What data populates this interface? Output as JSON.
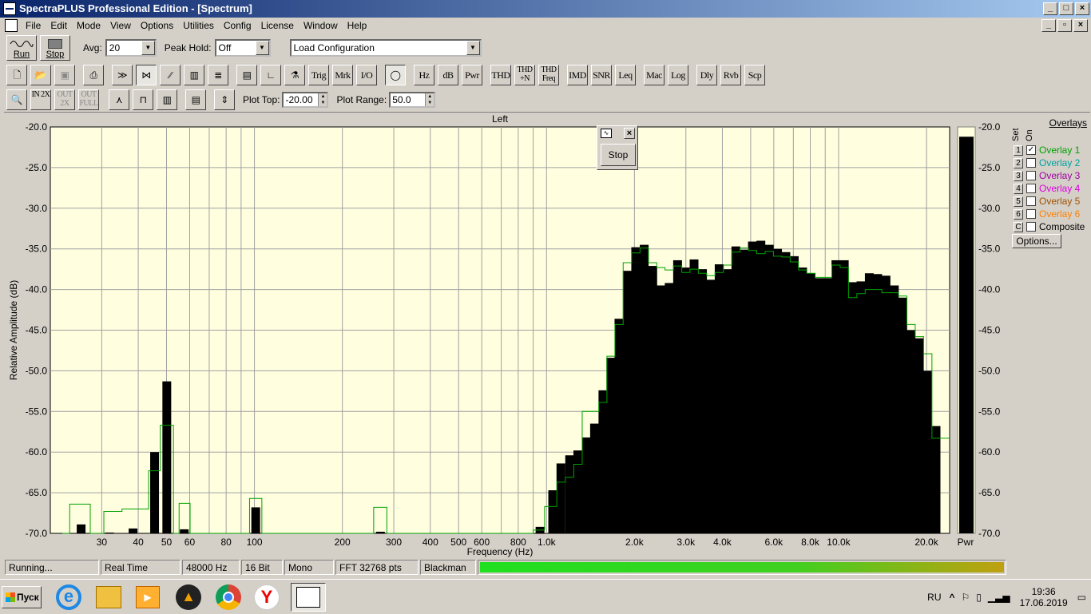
{
  "window": {
    "title": "SpectraPLUS Professional Edition - [Spectrum]"
  },
  "menu": [
    "File",
    "Edit",
    "Mode",
    "View",
    "Options",
    "Utilities",
    "Config",
    "License",
    "Window",
    "Help"
  ],
  "toolbar1": {
    "run": "Run",
    "stop": "Stop",
    "avg_label": "Avg:",
    "avg_value": "20",
    "peak_label": "Peak Hold:",
    "peak_value": "Off",
    "config_value": "Load Configuration"
  },
  "toolbar2": [
    "Trig",
    "Mrk",
    "I/O",
    "Hz",
    "dB",
    "Pwr",
    "THD",
    "THD +N",
    "THD Freq",
    "IMD",
    "SNR",
    "Leq",
    "Mac",
    "Log",
    "Dly",
    "Rvb",
    "Scp"
  ],
  "toolbar3": {
    "zoom_in": "IN 2X",
    "zoom_out": "OUT 2X",
    "zoom_full": "OUT FULL",
    "plot_top_label": "Plot Top:",
    "plot_top_value": "-20.00",
    "plot_range_label": "Plot Range:",
    "plot_range_value": "50.0"
  },
  "float_dialog": {
    "stop": "Stop"
  },
  "overlays": {
    "title": "Overlays",
    "set": "Set",
    "on": "On",
    "items": [
      {
        "num": "1",
        "label": "Overlay 1",
        "checked": true,
        "color": "#00a000"
      },
      {
        "num": "2",
        "label": "Overlay 2",
        "checked": false,
        "color": "#00a0a0"
      },
      {
        "num": "3",
        "label": "Overlay 3",
        "checked": false,
        "color": "#a000a0"
      },
      {
        "num": "4",
        "label": "Overlay 4",
        "checked": false,
        "color": "#e000e0"
      },
      {
        "num": "5",
        "label": "Overlay 5",
        "checked": false,
        "color": "#a05000"
      },
      {
        "num": "6",
        "label": "Overlay 6",
        "checked": false,
        "color": "#ff7f00"
      },
      {
        "num": "C",
        "label": "Composite",
        "checked": false,
        "color": "#000000"
      }
    ],
    "options": "Options..."
  },
  "status": {
    "state": "Running...",
    "mode": "Real Time",
    "rate": "48000 Hz",
    "bits": "16 Bit",
    "channels": "Mono",
    "fft": "FFT 32768 pts",
    "window": "Blackman"
  },
  "taskbar": {
    "start": "Пуск",
    "lang": "RU",
    "time": "19:36",
    "date": "17.06.2019"
  },
  "chart_data": {
    "type": "bar",
    "title": "Left",
    "xlabel": "Frequency (Hz)",
    "ylabel": "Relative Amplitude (dB)",
    "ylim": [
      -70,
      -20
    ],
    "xscale": "log",
    "xlim": [
      20,
      24000
    ],
    "yticks": [
      "-20.0",
      "-25.0",
      "-30.0",
      "-35.0",
      "-40.0",
      "-45.0",
      "-50.0",
      "-55.0",
      "-60.0",
      "-65.0",
      "-70.0"
    ],
    "xticks": [
      {
        "v": 30,
        "t": "30"
      },
      {
        "v": 40,
        "t": "40"
      },
      {
        "v": 50,
        "t": "50"
      },
      {
        "v": 60,
        "t": "60"
      },
      {
        "v": 80,
        "t": "80"
      },
      {
        "v": 100,
        "t": "100"
      },
      {
        "v": 200,
        "t": "200"
      },
      {
        "v": 300,
        "t": "300"
      },
      {
        "v": 400,
        "t": "400"
      },
      {
        "v": 500,
        "t": "500"
      },
      {
        "v": 600,
        "t": "600"
      },
      {
        "v": 800,
        "t": "800"
      },
      {
        "v": 1000,
        "t": "1.0k"
      },
      {
        "v": 2000,
        "t": "2.0k"
      },
      {
        "v": 3000,
        "t": "3.0k"
      },
      {
        "v": 4000,
        "t": "4.0k"
      },
      {
        "v": 6000,
        "t": "6.0k"
      },
      {
        "v": 8000,
        "t": "8.0k"
      },
      {
        "v": 10000,
        "t": "10.0k"
      },
      {
        "v": 20000,
        "t": "20.0k"
      }
    ],
    "bars": [
      [
        25.5,
        -68.9
      ],
      [
        31.9,
        -69.9
      ],
      [
        38.4,
        -69.4
      ],
      [
        45.5,
        -60.0
      ],
      [
        50.1,
        -51.3
      ],
      [
        57.5,
        -69.5
      ],
      [
        101,
        -66.8
      ],
      [
        270,
        -69.8
      ],
      [
        950,
        -69.2
      ],
      [
        1050,
        -64.7
      ],
      [
        1120,
        -61.4
      ],
      [
        1200,
        -60.4
      ],
      [
        1280,
        -59.8
      ],
      [
        1370,
        -58.2
      ],
      [
        1460,
        -56.5
      ],
      [
        1560,
        -52.4
      ],
      [
        1660,
        -48.4
      ],
      [
        1770,
        -43.6
      ],
      [
        1890,
        -37.7
      ],
      [
        2020,
        -34.8
      ],
      [
        2160,
        -34.5
      ],
      [
        2310,
        -37.1
      ],
      [
        2460,
        -39.5
      ],
      [
        2630,
        -39.2
      ],
      [
        2810,
        -36.4
      ],
      [
        3000,
        -37.3
      ],
      [
        3200,
        -36.3
      ],
      [
        3420,
        -37.5
      ],
      [
        3650,
        -38.8
      ],
      [
        3900,
        -36.9
      ],
      [
        4170,
        -37.5
      ],
      [
        4450,
        -34.7
      ],
      [
        4750,
        -35.1
      ],
      [
        5070,
        -34.1
      ],
      [
        5420,
        -34.0
      ],
      [
        5790,
        -34.5
      ],
      [
        6180,
        -35.0
      ],
      [
        6600,
        -35.4
      ],
      [
        7050,
        -35.9
      ],
      [
        7530,
        -37.3
      ],
      [
        8040,
        -38.0
      ],
      [
        8590,
        -38.6
      ],
      [
        9170,
        -38.6
      ],
      [
        9790,
        -36.4
      ],
      [
        10460,
        -36.4
      ],
      [
        11170,
        -39.1
      ],
      [
        11930,
        -39.0
      ],
      [
        12740,
        -38.0
      ],
      [
        13610,
        -38.1
      ],
      [
        14530,
        -38.3
      ],
      [
        15520,
        -39.5
      ],
      [
        16580,
        -41.0
      ],
      [
        17700,
        -45.0
      ],
      [
        18900,
        -46.0
      ],
      [
        20190,
        -50.0
      ],
      [
        21560,
        -56.8
      ]
    ],
    "overlay_steps": [
      [
        22,
        -70
      ],
      [
        23.3,
        -66.4
      ],
      [
        27.4,
        -70
      ],
      [
        30.5,
        -67.3
      ],
      [
        35.2,
        -67.0
      ],
      [
        43.4,
        -62.3
      ],
      [
        47.6,
        -56.7
      ],
      [
        52.8,
        -70
      ],
      [
        55.2,
        -66.3
      ],
      [
        60.2,
        -70
      ],
      [
        96.2,
        -65.7
      ],
      [
        106,
        -70
      ],
      [
        256,
        -66.8
      ],
      [
        284,
        -70
      ],
      [
        900,
        -69.6
      ],
      [
        985,
        -66.7
      ],
      [
        1085,
        -63.7
      ],
      [
        1160,
        -63.1
      ],
      [
        1240,
        -61.5
      ],
      [
        1325,
        -55.0
      ],
      [
        1415,
        -55.0
      ],
      [
        1510,
        -53.9
      ],
      [
        1610,
        -48.2
      ],
      [
        1715,
        -44.3
      ],
      [
        1830,
        -36.7
      ],
      [
        1955,
        -35.5
      ],
      [
        2090,
        -34.9
      ],
      [
        2235,
        -36.7
      ],
      [
        2385,
        -37.3
      ],
      [
        2545,
        -37.6
      ],
      [
        2720,
        -37.1
      ],
      [
        2905,
        -37.9
      ],
      [
        3100,
        -37.5
      ],
      [
        3310,
        -38.0
      ],
      [
        3535,
        -38.3
      ],
      [
        3775,
        -37.9
      ],
      [
        4035,
        -37.0
      ],
      [
        4305,
        -35.4
      ],
      [
        4600,
        -34.9
      ],
      [
        4910,
        -35.2
      ],
      [
        5245,
        -35.6
      ],
      [
        5605,
        -35.3
      ],
      [
        5985,
        -35.9
      ],
      [
        6390,
        -36.0
      ],
      [
        6825,
        -36.6
      ],
      [
        7290,
        -37.6
      ],
      [
        7785,
        -38.0
      ],
      [
        8315,
        -38.5
      ],
      [
        8880,
        -38.5
      ],
      [
        9480,
        -37.0
      ],
      [
        10125,
        -37.3
      ],
      [
        10815,
        -41.0
      ],
      [
        11550,
        -40.5
      ],
      [
        12335,
        -40.0
      ],
      [
        13175,
        -40.0
      ],
      [
        14070,
        -40.4
      ],
      [
        15025,
        -40.4
      ],
      [
        16050,
        -40.8
      ],
      [
        17140,
        -44.3
      ],
      [
        18300,
        -45.8
      ],
      [
        19550,
        -47.9
      ],
      [
        20875,
        -58.3
      ],
      [
        22300,
        -58.3
      ]
    ],
    "meter": {
      "label": "Pwr",
      "value": -21.2,
      "yticks": [
        "-20.0",
        "-25.0",
        "-30.0",
        "-35.0",
        "-40.0",
        "-45.0",
        "-50.0",
        "-55.0",
        "-60.0",
        "-65.0",
        "-70.0"
      ]
    }
  }
}
